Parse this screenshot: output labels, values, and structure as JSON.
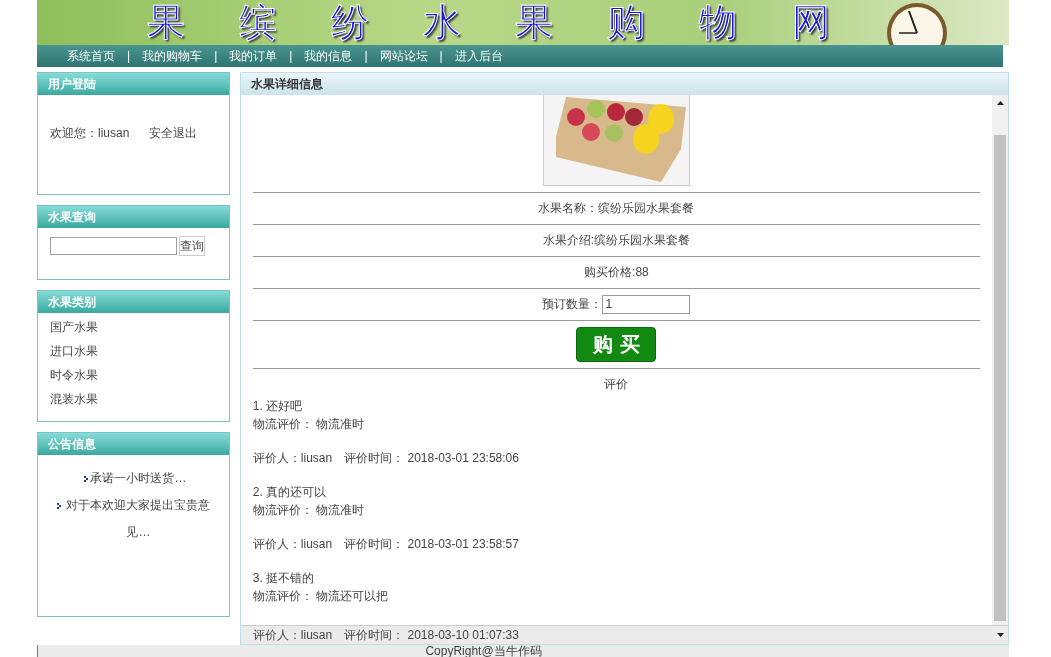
{
  "banner": {
    "title": "果 缤 纷 水 果 购 物 网"
  },
  "nav": {
    "separator": "|",
    "items": [
      "系统首页",
      "我的购物车",
      "我的订单",
      "我的信息",
      "网站论坛",
      "进入后台"
    ]
  },
  "sidebar": {
    "login": {
      "title": "用户登陆",
      "welcome": "欢迎您：liusan",
      "logout": "安全退出"
    },
    "search": {
      "title": "水果查询",
      "button": "查询"
    },
    "categories": {
      "title": "水果类别",
      "items": [
        "国产水果",
        "进口水果",
        "时令水果",
        "混装水果"
      ]
    },
    "notices": {
      "title": "公告信息",
      "items": [
        "承诺一小时送货…",
        "对于本欢迎大家提出宝贵意见…"
      ]
    }
  },
  "detail": {
    "title": "水果详细信息",
    "name": "水果名称：缤纷乐园水果套餐",
    "intro": "水果介绍:缤纷乐园水果套餐",
    "price": "购买价格:88",
    "quantity_label": "预订数量：",
    "quantity": "1",
    "buy_button": "购 买",
    "reviews_title": "评价",
    "reviews": [
      {
        "title": "1.  还好吧",
        "logistics": "物流评价： 物流准时",
        "byline": "评价人：liusan　评价时间： 2018-03-01 23:58:06"
      },
      {
        "title": "2.  真的还可以",
        "logistics": "物流评价： 物流准时",
        "byline": "评价人：liusan　评价时间： 2018-03-01 23:58:57"
      },
      {
        "title": "3.  挺不错的",
        "logistics": "物流评价： 物流还可以把",
        "byline": "评价人：liusan　评价时间： 2018-03-10 01:07:33"
      }
    ]
  },
  "footer": "CopyRight@当牛作码"
}
